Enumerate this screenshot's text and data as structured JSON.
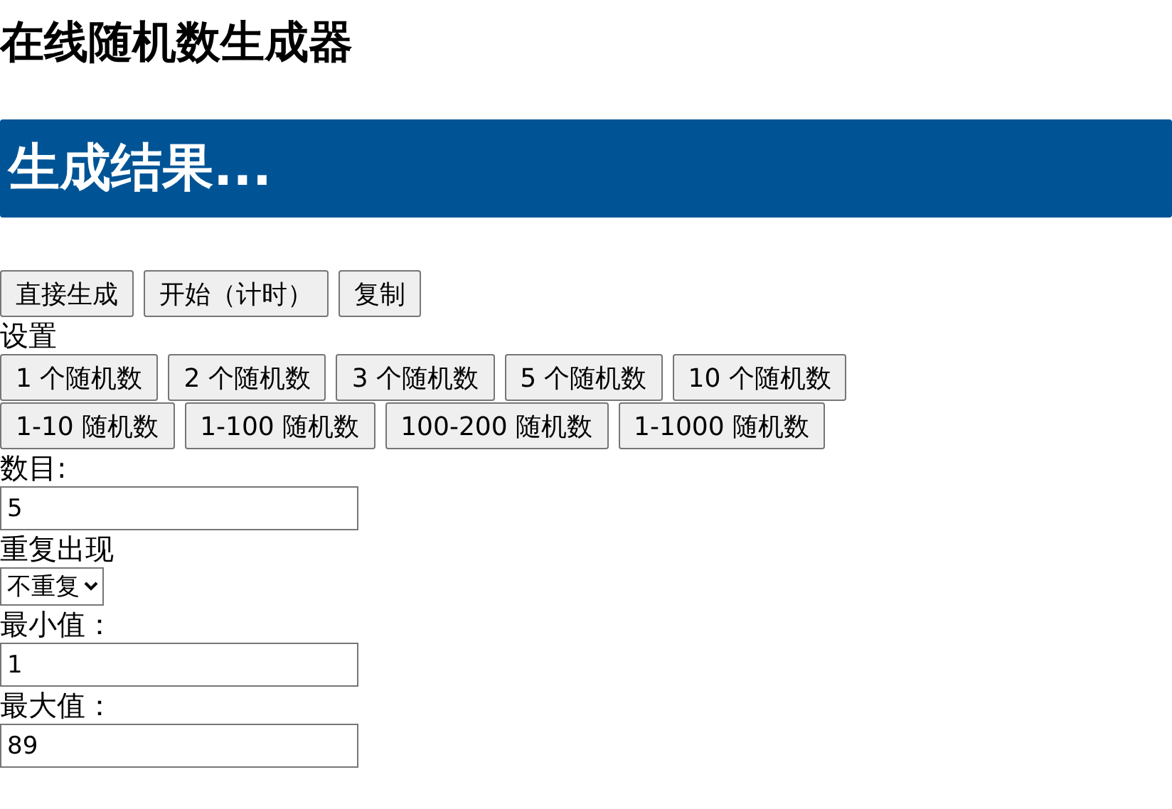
{
  "title": "在线随机数生成器",
  "result": "生成结果...",
  "actions": [
    "直接生成",
    "开始（计时）",
    "复制"
  ],
  "settings_label": "设置",
  "count_presets": [
    "1 个随机数",
    "2 个随机数",
    "3 个随机数",
    "5 个随机数",
    "10 个随机数"
  ],
  "range_presets": [
    "1-10 随机数",
    "1-100 随机数",
    "100-200 随机数",
    "1-1000 随机数"
  ],
  "fields": [
    {
      "kind": "input",
      "label": "数目:",
      "value": "5"
    },
    {
      "kind": "select",
      "label": "重复出现",
      "value": "不重复"
    },
    {
      "kind": "input",
      "label": "最小值：",
      "value": "1"
    },
    {
      "kind": "input",
      "label": "最大值：",
      "value": "89"
    }
  ]
}
